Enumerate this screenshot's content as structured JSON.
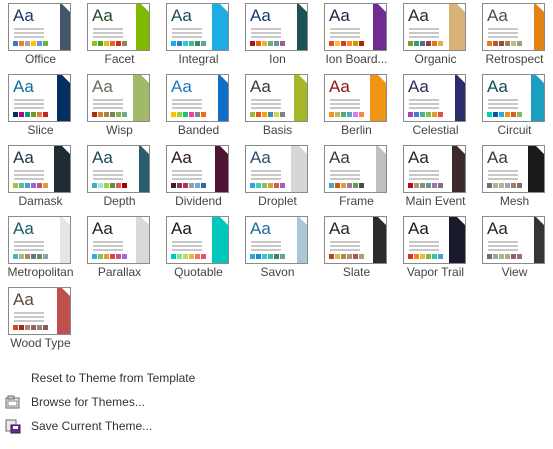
{
  "themes": [
    {
      "name": "Office",
      "aa": "#1f3864",
      "accent": "#44546a",
      "swatches": [
        "#4472c4",
        "#ed7d31",
        "#a5a5a5",
        "#ffc000",
        "#5b9bd5",
        "#70ad47"
      ]
    },
    {
      "name": "Facet",
      "aa": "#1e4d2b",
      "accent": "#7fba00",
      "swatches": [
        "#90c226",
        "#54a021",
        "#e6b91e",
        "#e76618",
        "#c42f1a",
        "#918655"
      ]
    },
    {
      "name": "Integral",
      "aa": "#1c4f5e",
      "accent": "#1cade4",
      "swatches": [
        "#1cade4",
        "#2683c6",
        "#27ced7",
        "#42ba97",
        "#3e8853",
        "#62a39f"
      ]
    },
    {
      "name": "Ion",
      "aa": "#17406d",
      "accent": "#1e5155",
      "swatches": [
        "#b01513",
        "#ea6312",
        "#e6b729",
        "#6aac90",
        "#5f9c9d",
        "#9e5e9b"
      ]
    },
    {
      "name": "Ion Board...",
      "aa": "#2e1a4b",
      "accent": "#6f2c91",
      "swatches": [
        "#e84c22",
        "#ffbd47",
        "#b64926",
        "#ff8427",
        "#cc9900",
        "#b22600"
      ]
    },
    {
      "name": "Organic",
      "aa": "#2f2a25",
      "accent": "#d9b278",
      "swatches": [
        "#83992a",
        "#3c9770",
        "#44709d",
        "#a23c33",
        "#d97828",
        "#deb340"
      ]
    },
    {
      "name": "Retrospect",
      "aa": "#4f4f4f",
      "accent": "#e48312",
      "swatches": [
        "#e48312",
        "#bd582c",
        "#865640",
        "#9b8357",
        "#c2bc80",
        "#94a088"
      ]
    },
    {
      "name": "Slice",
      "aa": "#0e6d9c",
      "accent": "#052f61",
      "swatches": [
        "#052f61",
        "#a50e82",
        "#14967c",
        "#6a9e1f",
        "#e87d37",
        "#c62324"
      ]
    },
    {
      "name": "Wisp",
      "aa": "#6b6b56",
      "accent": "#a2b969",
      "swatches": [
        "#a53010",
        "#de7e18",
        "#9f8351",
        "#728653",
        "#92aa4c",
        "#6aac91"
      ]
    },
    {
      "name": "Banded",
      "aa": "#1c7ab8",
      "accent": "#0f6fc6",
      "swatches": [
        "#ffc000",
        "#a5d028",
        "#08cc78",
        "#f24099",
        "#828288",
        "#f56617"
      ]
    },
    {
      "name": "Basis",
      "aa": "#3a3a3a",
      "accent": "#a6b727",
      "swatches": [
        "#a6b727",
        "#df5327",
        "#fe9e00",
        "#418ab3",
        "#d7d447",
        "#818183"
      ]
    },
    {
      "name": "Berlin",
      "aa": "#8b1a0e",
      "accent": "#f09415",
      "swatches": [
        "#f09415",
        "#c1b56b",
        "#4baf73",
        "#5aa6c0",
        "#d17df9",
        "#fa7e5c"
      ]
    },
    {
      "name": "Celestial",
      "aa": "#2e2e5c",
      "accent": "#2c2c6b",
      "swatches": [
        "#ac3ec1",
        "#477bd1",
        "#46b298",
        "#90ba4c",
        "#dd9d31",
        "#e25247"
      ]
    },
    {
      "name": "Circuit",
      "aa": "#0f4e5c",
      "accent": "#1a9fc2",
      "swatches": [
        "#03d4a8",
        "#005e9a",
        "#15aff2",
        "#f98f08",
        "#d46120",
        "#86b85c"
      ]
    },
    {
      "name": "Damask",
      "aa": "#1b3a4a",
      "accent": "#1e2d34",
      "swatches": [
        "#9ec544",
        "#50bea3",
        "#4a9ccc",
        "#9a66ca",
        "#c54f71",
        "#de9c3c"
      ]
    },
    {
      "name": "Depth",
      "aa": "#1a4a5e",
      "accent": "#2a5d6e",
      "swatches": [
        "#41aebd",
        "#97e9d5",
        "#a2cf49",
        "#608f3d",
        "#dd5a5a",
        "#a80000"
      ]
    },
    {
      "name": "Dividend",
      "aa": "#2a1a1a",
      "accent": "#4d1434",
      "swatches": [
        "#4d1434",
        "#903163",
        "#b2324b",
        "#969fa7",
        "#66b1ce",
        "#40619d"
      ]
    },
    {
      "name": "Droplet",
      "aa": "#2e4d6b",
      "accent": "#d6d6d6",
      "swatches": [
        "#2fa3ee",
        "#4bcaad",
        "#86c157",
        "#d99c3f",
        "#ce6633",
        "#a35dd1"
      ]
    },
    {
      "name": "Frame",
      "aa": "#3a3a3a",
      "accent": "#bfbfbf",
      "swatches": [
        "#40a7c2",
        "#da4f18",
        "#cda23f",
        "#a47a9b",
        "#6b9a4b",
        "#4c4c4c"
      ]
    },
    {
      "name": "Main Event",
      "aa": "#262626",
      "accent": "#3b2b2b",
      "swatches": [
        "#b80e0f",
        "#a6987d",
        "#7f9a71",
        "#64969f",
        "#9b75b2",
        "#80737a"
      ]
    },
    {
      "name": "Mesh",
      "aa": "#3a3a3a",
      "accent": "#1a1a1a",
      "swatches": [
        "#6f6f74",
        "#a7b789",
        "#beae98",
        "#92a9b9",
        "#9c8265",
        "#8d6974"
      ]
    },
    {
      "name": "Metropolitan",
      "aa": "#1a5a6e",
      "accent": "#e5e5e5",
      "swatches": [
        "#50b4c8",
        "#a8b97f",
        "#9b9256",
        "#657689",
        "#7a855d",
        "#84ac9d"
      ]
    },
    {
      "name": "Parallax",
      "aa": "#262626",
      "accent": "#d9d9d9",
      "swatches": [
        "#30acec",
        "#80c34f",
        "#e29d3e",
        "#d64a3b",
        "#d64787",
        "#a666e1"
      ]
    },
    {
      "name": "Quotable",
      "aa": "#1a1a1a",
      "accent": "#00c6bb",
      "swatches": [
        "#00c6bb",
        "#6feba0",
        "#b6df5e",
        "#efb251",
        "#ef755f",
        "#ed515c"
      ]
    },
    {
      "name": "Savon",
      "aa": "#1c6e9c",
      "accent": "#a8c8d8",
      "swatches": [
        "#1cade4",
        "#2683c6",
        "#27ced7",
        "#42ba97",
        "#3e8853",
        "#62a39f"
      ]
    },
    {
      "name": "Slate",
      "aa": "#262626",
      "accent": "#2b2b2b",
      "swatches": [
        "#bc451b",
        "#d3ba68",
        "#bb8640",
        "#ad9277",
        "#a55a43",
        "#ad9d7b"
      ]
    },
    {
      "name": "Vapor Trail",
      "aa": "#1a1a1a",
      "accent": "#1a1a2e",
      "swatches": [
        "#df2e28",
        "#fe801a",
        "#e9bf35",
        "#81bb42",
        "#32c7a9",
        "#4a9bdc"
      ]
    },
    {
      "name": "View",
      "aa": "#262626",
      "accent": "#353535",
      "swatches": [
        "#6f6f74",
        "#92a9b9",
        "#a7b789",
        "#b9a489",
        "#8d6374",
        "#9b7362"
      ]
    },
    {
      "name": "Wood Type",
      "aa": "#5a4a3a",
      "accent": "#c0504d",
      "swatches": [
        "#d34817",
        "#9b2d1f",
        "#a28e6a",
        "#956251",
        "#918485",
        "#855d5d"
      ]
    }
  ],
  "menu": {
    "reset": {
      "label": "Reset to Theme from Template",
      "icon": "none"
    },
    "browse": {
      "label": "Browse for Themes...",
      "icon": "folder-open-icon"
    },
    "save": {
      "label": "Save Current Theme...",
      "icon": "save-theme-icon"
    }
  }
}
